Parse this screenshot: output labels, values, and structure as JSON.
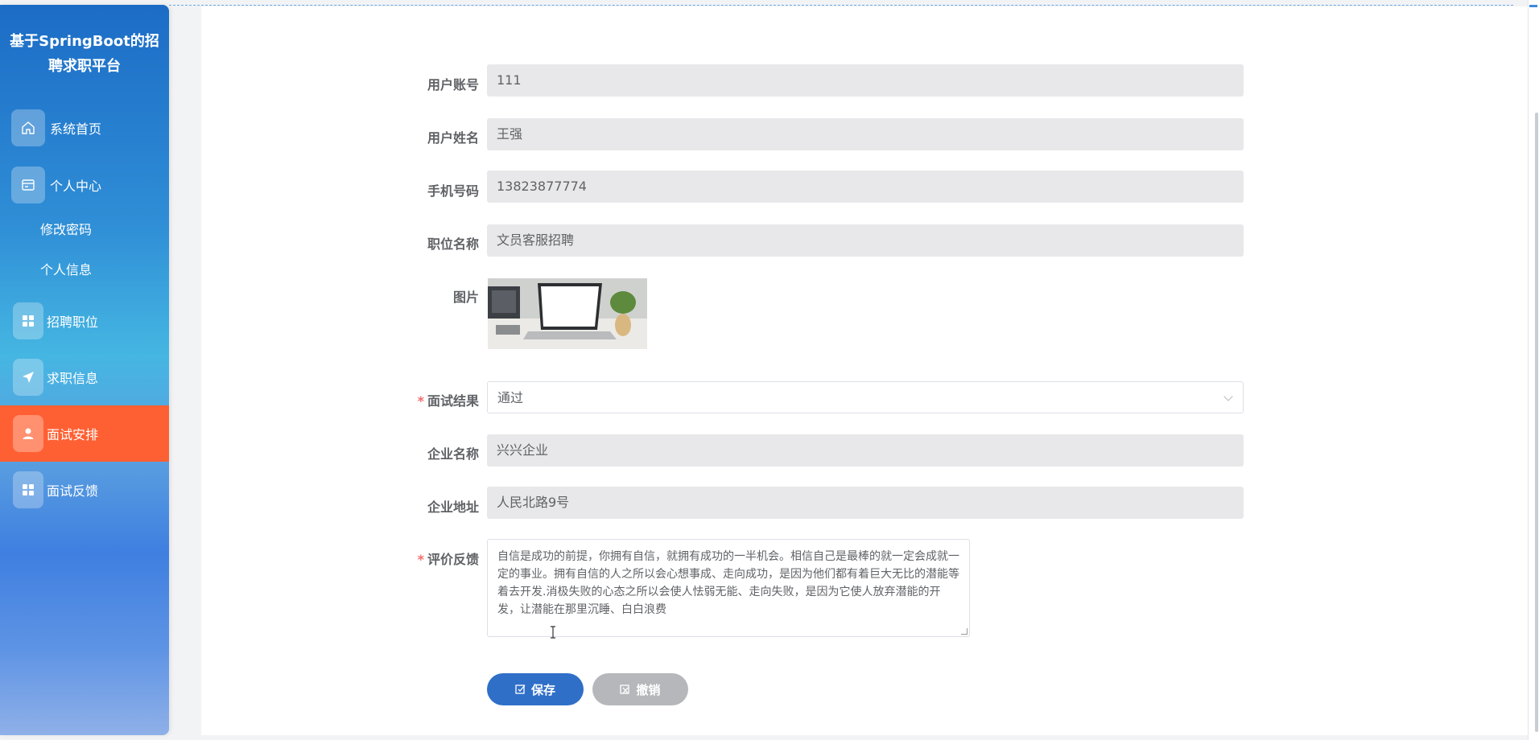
{
  "sidebar": {
    "title": "基于SpringBoot的招聘求职平台",
    "items": [
      {
        "label": "系统首页",
        "icon": "home-icon"
      },
      {
        "label": "个人中心",
        "icon": "card-icon"
      },
      {
        "label": "招聘职位",
        "icon": "grid-icon"
      },
      {
        "label": "求职信息",
        "icon": "send-icon"
      },
      {
        "label": "面试安排",
        "icon": "user-icon",
        "active": true
      },
      {
        "label": "面试反馈",
        "icon": "grid-icon"
      }
    ],
    "sub_items": [
      "修改密码",
      "个人信息"
    ],
    "active_color": "#ff6033"
  },
  "form": {
    "account": {
      "label": "用户账号",
      "value": "111"
    },
    "name": {
      "label": "用户姓名",
      "value": "王强"
    },
    "phone": {
      "label": "手机号码",
      "value": "13823877774"
    },
    "position": {
      "label": "职位名称",
      "value": "文员客服招聘"
    },
    "image": {
      "label": "图片"
    },
    "result": {
      "label": "面试结果",
      "value": "通过",
      "required": "*"
    },
    "company": {
      "label": "企业名称",
      "value": "兴兴企业"
    },
    "address": {
      "label": "企业地址",
      "value": "人民北路9号"
    },
    "feedback": {
      "label": "评价反馈",
      "required": "*",
      "value": "自信是成功的前提，你拥有自信，就拥有成功的一半机会。相信自己是最棒的就一定会成就一定的事业。拥有自信的人之所以会心想事成、走向成功，是因为他们都有着巨大无比的潜能等着去开发.消极失败的心态之所以会使人怯弱无能、走向失败，是因为它使人放弃潜能的开发，让潜能在那里沉睡、白白浪费"
    }
  },
  "buttons": {
    "save": "保存",
    "cancel": "撤销"
  }
}
